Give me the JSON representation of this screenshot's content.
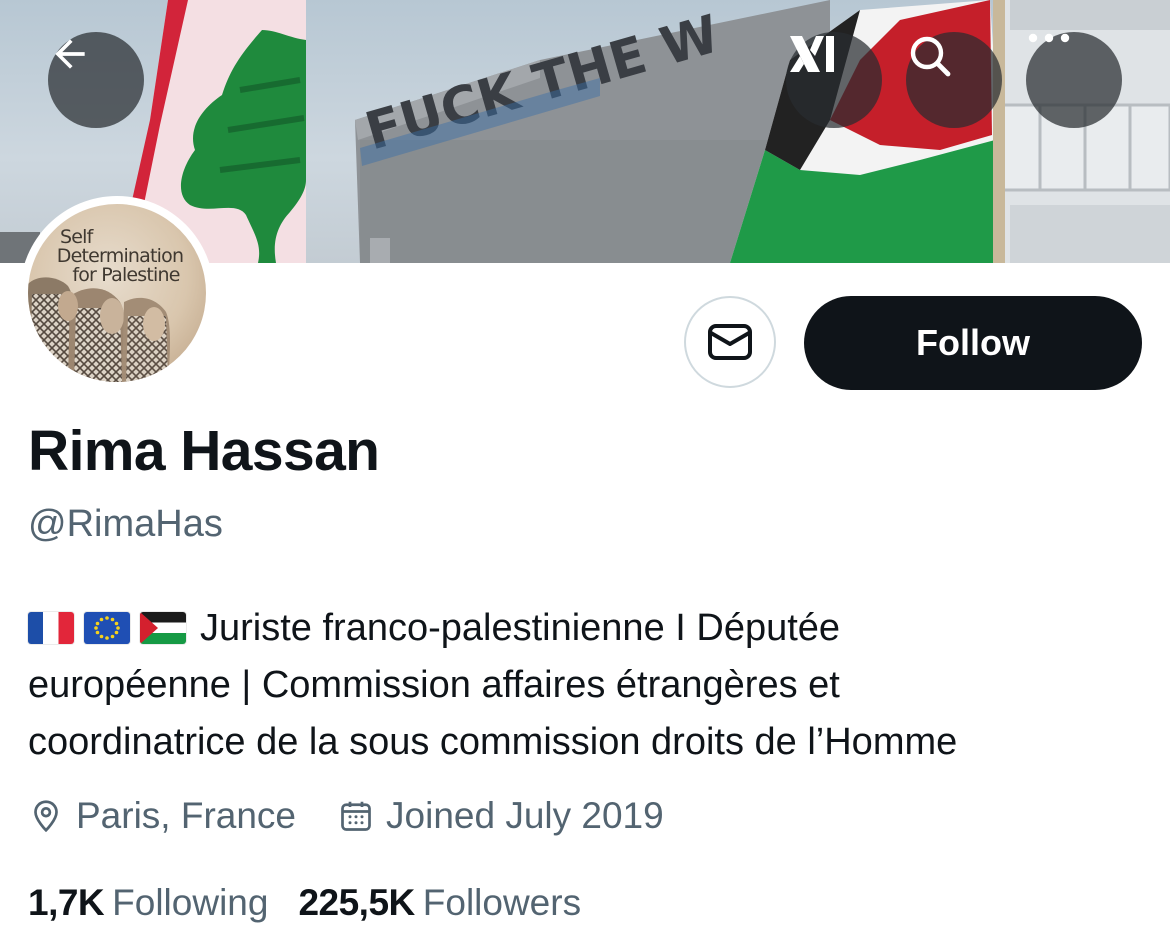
{
  "banner": {
    "graffiti_text": "FUCK THE W",
    "sky_color": "#c4d0d9"
  },
  "toolbar": {
    "back_icon": "arrow-left-icon",
    "grok_icon": "grok-logo-icon",
    "search_icon": "search-icon",
    "more_icon": "more-horizontal-icon"
  },
  "avatar": {
    "line1": "Self",
    "line2": "Determination",
    "line3": "for Palestine"
  },
  "actions": {
    "message_icon": "envelope-icon",
    "follow_label": "Follow"
  },
  "profile": {
    "name": "Rima Hassan",
    "handle": "@RimaHas",
    "bio_flags": [
      "france-flag",
      "eu-flag",
      "palestine-flag"
    ],
    "bio_line1": "Juriste franco-palestinienne I Députée",
    "bio_line2": "européenne | Commission affaires étrangères et",
    "bio_line3": "coordinatrice de la sous commission droits de l’Homme",
    "location": "Paris, France",
    "joined": "Joined July 2019"
  },
  "stats": {
    "following_count": "1,7K",
    "following_label": "Following",
    "followers_count": "225,5K",
    "followers_label": "Followers"
  },
  "colors": {
    "text_primary": "#0f1419",
    "text_secondary": "#536471",
    "button_dark": "#0f1419",
    "border": "#cfd9de"
  }
}
